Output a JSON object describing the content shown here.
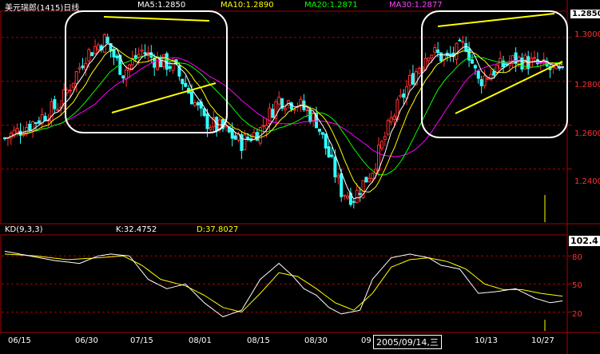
{
  "header": {
    "title": "美元瑞郎(1415)日线",
    "ma5": "MA5:1.2850",
    "ma10": "MA10:1.2890",
    "ma20": "MA20:1.2871",
    "ma30": "MA30:1.2877"
  },
  "price_axis": {
    "labels": [
      "1.2850",
      "1.3000",
      "1.2800",
      "1.2600",
      "1.2400"
    ],
    "current_label": "1.2850"
  },
  "kd_header": {
    "name": "KD(9,3,3)",
    "k": "K:32.4752",
    "d": "D:37.8027"
  },
  "kd_axis": {
    "labels": [
      "80",
      "50",
      "20"
    ],
    "current_label": "102.4"
  },
  "date_axis": {
    "labels": [
      "06/15",
      "06/30",
      "07/15",
      "08/01",
      "08/15",
      "08/30",
      "09",
      "10/13",
      "10/27"
    ],
    "cursor_label": "2005/09/14,三"
  },
  "colors": {
    "up": "#ff3030",
    "down": "#33ffff",
    "ma5": "#ffffff",
    "ma10": "#ffff00",
    "ma20": "#00ff00",
    "ma30": "#ff00ff",
    "trendline": "#ffff00",
    "grid": "#aa0000",
    "k_line": "#ffffff",
    "d_line": "#ffff00"
  },
  "chart_data": [
    {
      "type": "candlestick",
      "title": "美元瑞郎(1415)日线",
      "ylim": [
        1.215,
        1.312
      ],
      "x": [
        "06/15",
        "06/30",
        "07/15",
        "08/01",
        "08/15",
        "08/30",
        "09/14",
        "10/13",
        "10/27"
      ],
      "close": [
        1.258,
        1.288,
        1.298,
        1.262,
        1.25,
        1.238,
        1.258,
        1.288,
        1.285
      ],
      "series": [
        {
          "name": "MA5",
          "latest": 1.285
        },
        {
          "name": "MA10",
          "latest": 1.289
        },
        {
          "name": "MA20",
          "latest": 1.2871
        },
        {
          "name": "MA30",
          "latest": 1.2877
        }
      ]
    },
    {
      "type": "line",
      "title": "KD(9,3,3)",
      "ylim": [
        0,
        102.4
      ],
      "ticks": [
        20,
        50,
        80
      ],
      "series": [
        {
          "name": "K",
          "latest": 32.4752
        },
        {
          "name": "D",
          "latest": 37.8027
        }
      ]
    }
  ]
}
